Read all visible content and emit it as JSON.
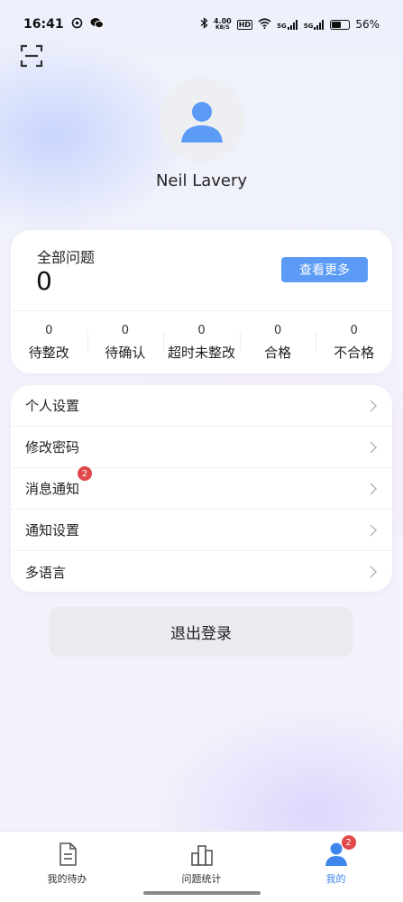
{
  "status_bar": {
    "time": "16:41",
    "speed": "4.00",
    "speed_unit": "KB/S",
    "hd": "HD",
    "net1": "5G",
    "net2": "5G",
    "battery_percent": "56%",
    "battery_level": 0.56
  },
  "profile": {
    "name": "Neil Lavery",
    "avatar_icon": "user-silhouette-icon"
  },
  "issues": {
    "title": "全部问题",
    "count": "0",
    "more_label": "查看更多",
    "stats": [
      {
        "value": "0",
        "label": "待整改"
      },
      {
        "value": "0",
        "label": "待确认"
      },
      {
        "value": "0",
        "label": "超时未整改"
      },
      {
        "value": "0",
        "label": "合格"
      },
      {
        "value": "0",
        "label": "不合格"
      }
    ]
  },
  "menu": {
    "items": [
      {
        "label": "个人设置"
      },
      {
        "label": "修改密码"
      },
      {
        "label": "消息通知",
        "badge": "2"
      },
      {
        "label": "通知设置"
      },
      {
        "label": "多语言"
      }
    ]
  },
  "logout_label": "退出登录",
  "tabs": [
    {
      "label": "我的待办",
      "icon": "document-icon"
    },
    {
      "label": "问题统计",
      "icon": "bar-chart-icon"
    },
    {
      "label": "我的",
      "icon": "user-icon",
      "badge": "2",
      "active": true
    }
  ],
  "colors": {
    "accent": "#5b9bf5",
    "active_tab": "#3f86ec",
    "badge": "#e0484a"
  }
}
